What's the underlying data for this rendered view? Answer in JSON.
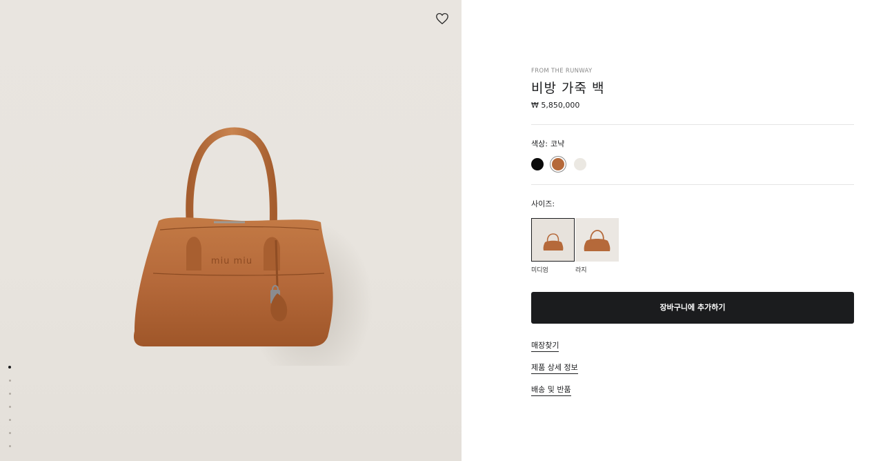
{
  "gallery": {
    "wishlist_icon": "heart-outline-icon",
    "image_count": 7,
    "active_image": 1
  },
  "product": {
    "eyebrow": "FROM THE RUNWAY",
    "title": "비방 가죽 백",
    "price": "₩ 5,850,000"
  },
  "color": {
    "label": "색상:",
    "selected": "코냑",
    "options": [
      {
        "name": "black",
        "hex": "#0b0b0b"
      },
      {
        "name": "cognac",
        "hex": "#b5693a"
      },
      {
        "name": "white",
        "hex": "#ebe8e2"
      }
    ]
  },
  "size": {
    "label": "사이즈:",
    "options": [
      {
        "label": "미디엄",
        "selected": true
      },
      {
        "label": "라지",
        "selected": false
      }
    ]
  },
  "cart_button": "장바구니에 추가하기",
  "links": {
    "store": "매장찾기",
    "details": "제품 상세 정보",
    "shipping": "배송 및 반품"
  },
  "colors": {
    "bag": "#b5693a",
    "button": "#1b1c1e",
    "gallery_bg": "#e9e5e0"
  }
}
